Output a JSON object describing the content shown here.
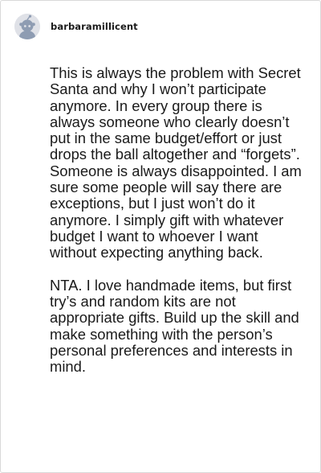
{
  "comment": {
    "author": "barbaramillicent",
    "avatar_icon": "default-user-avatar-icon",
    "paragraphs": [
      "This is always the problem with Secret Santa and why I won’t participate anymore. In every group there is always someone who clearly doesn’t put in the same budget/effort or just drops the ball altogether and “forgets”. Someone is always disappointed. I am sure some people will say there are exceptions, but I just won’t do it anymore. I simply gift with whatever budget I want to whoever I want without expecting anything back.",
      "NTA. I love handmade items, but first try’s and random kits are not appropriate gifts. Build up the skill and make something with the person’s personal preferences and interests in mind."
    ]
  },
  "colors": {
    "avatar_bg": "#dfe1e7",
    "avatar_figure": "#8e9cb2",
    "text": "#1a1a1a",
    "border": "#d9d9d9"
  }
}
